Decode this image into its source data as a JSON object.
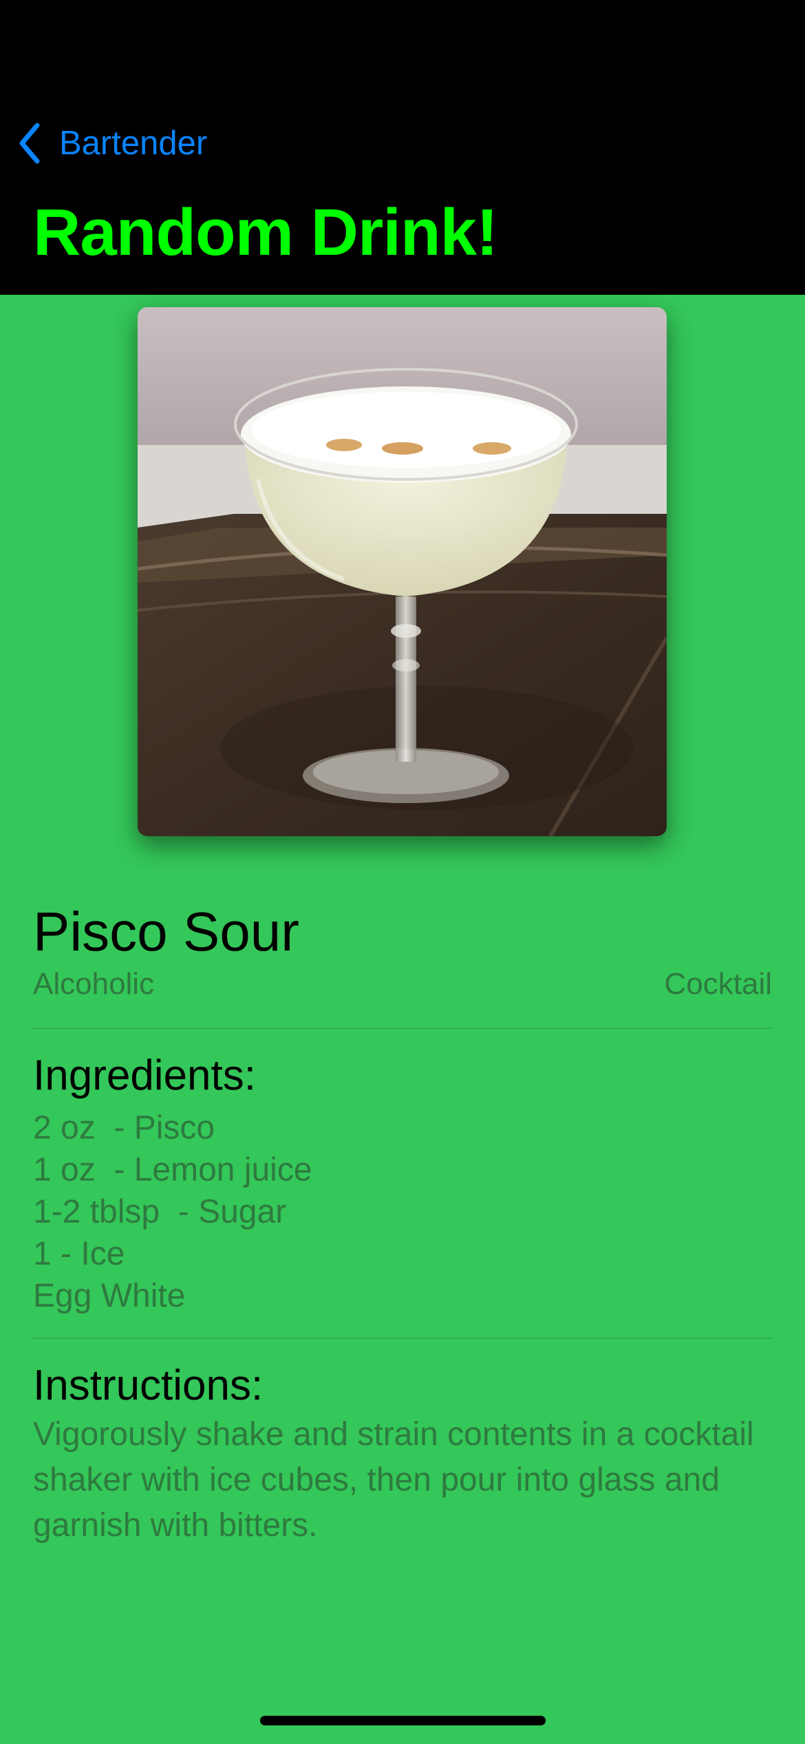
{
  "nav": {
    "back_label": "Bartender",
    "back_icon": "chevron-left-icon",
    "title": "Random Drink!"
  },
  "drink": {
    "name": "Pisco Sour",
    "alcoholic": "Alcoholic",
    "category": "Cocktail",
    "ingredients_title": "Ingredients:",
    "ingredients": [
      "2 oz  - Pisco",
      "1 oz  - Lemon juice",
      "1-2 tblsp  - Sugar",
      "1 - Ice",
      "Egg White"
    ],
    "instructions_title": "Instructions:",
    "instructions": "Vigorously shake and strain contents in a cocktail shaker with ice cubes, then pour into glass and garnish with bitters."
  },
  "colors": {
    "background": "#34c759",
    "header": "#000000",
    "title": "#00ff00",
    "link": "#0a84ff",
    "secondary_text": "#2e7a3f"
  }
}
